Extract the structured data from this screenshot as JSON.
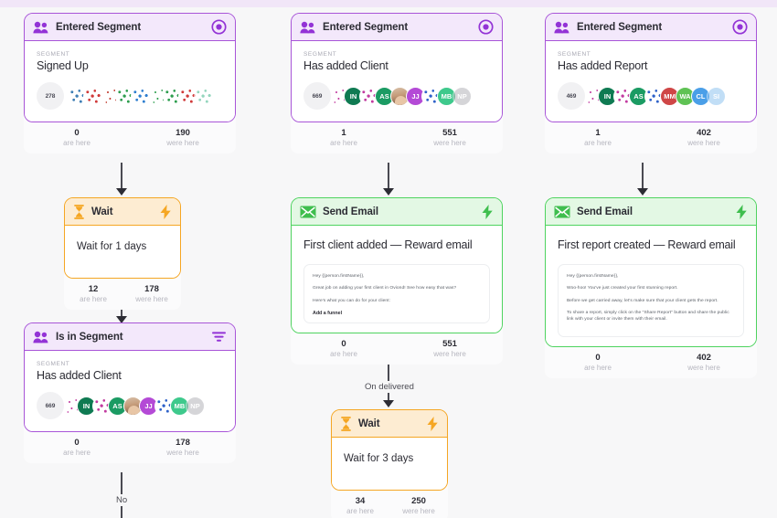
{
  "canvas": {
    "background": "#f7f7f8",
    "top_strip_color": "#f1e6f8"
  },
  "colors": {
    "purple": "#a855d8",
    "purple_header": "#f3e8fb",
    "orange": "#f5a623",
    "orange_header": "#fdecd2",
    "green": "#4ed35f",
    "green_header": "#e3f8e4",
    "stat_bar": "#fbfbfc",
    "connector": "#2c2c34"
  },
  "labels": {
    "segment_caption": "SEGMENT",
    "are_here": "are here",
    "were_here": "were here"
  },
  "branch_labels": {
    "no": "No",
    "on_delivered": "On delivered"
  },
  "nodes": {
    "trigger_signed_up": {
      "header": "Entered Segment",
      "header_icon": "people-icon",
      "action_icon": "target-icon",
      "segment_caption": "SEGMENT",
      "segment_name": "Signed Up",
      "audience_count": "278",
      "avatars": [
        {
          "type": "noisy",
          "color": "#3f7fb5",
          "initials": ""
        },
        {
          "type": "noisy",
          "color": "#d03a3a",
          "initials": ""
        },
        {
          "type": "dots",
          "color": "#c0392b",
          "initials": ""
        },
        {
          "type": "noisy",
          "color": "#2e9e4f",
          "initials": ""
        },
        {
          "type": "noisy",
          "color": "#2f7fd0",
          "initials": ""
        },
        {
          "type": "dots",
          "color": "#2e9e4f",
          "initials": ""
        },
        {
          "type": "noisy",
          "color": "#2e9e4f",
          "initials": ""
        },
        {
          "type": "noisy",
          "color": "#d03a3a",
          "initials": ""
        },
        {
          "type": "noisy",
          "color": "#3fb58a",
          "initials": ""
        }
      ],
      "stat_are_here": "0",
      "stat_were_here": "190"
    },
    "wait_1_day": {
      "header": "Wait",
      "header_icon": "hourglass-icon",
      "action_icon": "lightning-icon",
      "body_text": "Wait for 1 days",
      "stat_are_here": "12",
      "stat_were_here": "178"
    },
    "is_in_segment": {
      "header": "Is in Segment",
      "header_icon": "people-icon",
      "action_icon": "filter-icon",
      "segment_caption": "SEGMENT",
      "segment_name": "Has added Client",
      "audience_count": "669",
      "avatars": [
        {
          "type": "dots",
          "color": "#c23ba0",
          "initials": ""
        },
        {
          "type": "solid",
          "color": "#0f7a52",
          "initials": "IN"
        },
        {
          "type": "noisy",
          "color": "#c23ba0",
          "initials": ""
        },
        {
          "type": "solid",
          "color": "#1b9b63",
          "initials": "AS"
        },
        {
          "type": "photo",
          "color": "#c49a78",
          "initials": ""
        },
        {
          "type": "solid",
          "color": "#b44ad6",
          "initials": "JJ"
        },
        {
          "type": "noisy",
          "color": "#2f62c9",
          "initials": ""
        },
        {
          "type": "solid",
          "color": "#3ec98c",
          "initials": "MB"
        },
        {
          "type": "solid",
          "color": "#b4b4ba",
          "initials": "NP"
        }
      ],
      "stat_are_here": "0",
      "stat_were_here": "178"
    },
    "trigger_added_client": {
      "header": "Entered Segment",
      "header_icon": "people-icon",
      "action_icon": "target-icon",
      "segment_caption": "SEGMENT",
      "segment_name": "Has added Client",
      "audience_count": "669",
      "avatars": [
        {
          "type": "dots",
          "color": "#c23ba0",
          "initials": ""
        },
        {
          "type": "solid",
          "color": "#0f7a52",
          "initials": "IN"
        },
        {
          "type": "noisy",
          "color": "#c23ba0",
          "initials": ""
        },
        {
          "type": "solid",
          "color": "#1b9b63",
          "initials": "AS"
        },
        {
          "type": "photo",
          "color": "#c49a78",
          "initials": ""
        },
        {
          "type": "solid",
          "color": "#b44ad6",
          "initials": "JJ"
        },
        {
          "type": "noisy",
          "color": "#2f62c9",
          "initials": ""
        },
        {
          "type": "solid",
          "color": "#3ec98c",
          "initials": "MB"
        },
        {
          "type": "solid",
          "color": "#b4b4ba",
          "initials": "NP"
        }
      ],
      "stat_are_here": "1",
      "stat_were_here": "551"
    },
    "email_first_client": {
      "header": "Send Email",
      "header_icon": "envelope-icon",
      "action_icon": "lightning-icon",
      "subject": "First client added — Reward email",
      "preview_lines": [
        "Hey {{person.firstName}},",
        "Great job on adding your first client in Oviond! See how easy that was?",
        "Here's what you can do for your client:"
      ],
      "preview_cta": "Add a funnel",
      "stat_are_here": "0",
      "stat_were_here": "551"
    },
    "wait_3_days": {
      "header": "Wait",
      "header_icon": "hourglass-icon",
      "action_icon": "lightning-icon",
      "body_text": "Wait for 3 days",
      "stat_are_here": "34",
      "stat_were_here": "250"
    },
    "trigger_added_report": {
      "header": "Entered Segment",
      "header_icon": "people-icon",
      "action_icon": "target-icon",
      "segment_caption": "SEGMENT",
      "segment_name": "Has added Report",
      "audience_count": "469",
      "avatars": [
        {
          "type": "dots",
          "color": "#c23ba0",
          "initials": ""
        },
        {
          "type": "solid",
          "color": "#0f7a52",
          "initials": "IN"
        },
        {
          "type": "noisy",
          "color": "#c23ba0",
          "initials": ""
        },
        {
          "type": "solid",
          "color": "#1b9b63",
          "initials": "AS"
        },
        {
          "type": "noisy",
          "color": "#2f62c9",
          "initials": ""
        },
        {
          "type": "solid",
          "color": "#cf4646",
          "initials": "MM"
        },
        {
          "type": "solid",
          "color": "#5fc254",
          "initials": "WA"
        },
        {
          "type": "solid",
          "color": "#4a9fe8",
          "initials": "CL"
        },
        {
          "type": "solid",
          "color": "#8fc4f0",
          "initials": "SI"
        }
      ],
      "stat_are_here": "1",
      "stat_were_here": "402"
    },
    "email_first_report": {
      "header": "Send Email",
      "header_icon": "envelope-icon",
      "action_icon": "lightning-icon",
      "subject": "First report created — Reward email",
      "preview_lines": [
        "Hey {{person.firstName}},",
        "Woo-hoo! You've just created your first stunning report.",
        "Before we get carried away, let's make sure that your client gets the report.",
        "To share a report, simply click on the \"Share Report\" button and share the public link with your client or invite them with their email."
      ],
      "preview_cta": "",
      "stat_are_here": "0",
      "stat_were_here": "402"
    }
  }
}
